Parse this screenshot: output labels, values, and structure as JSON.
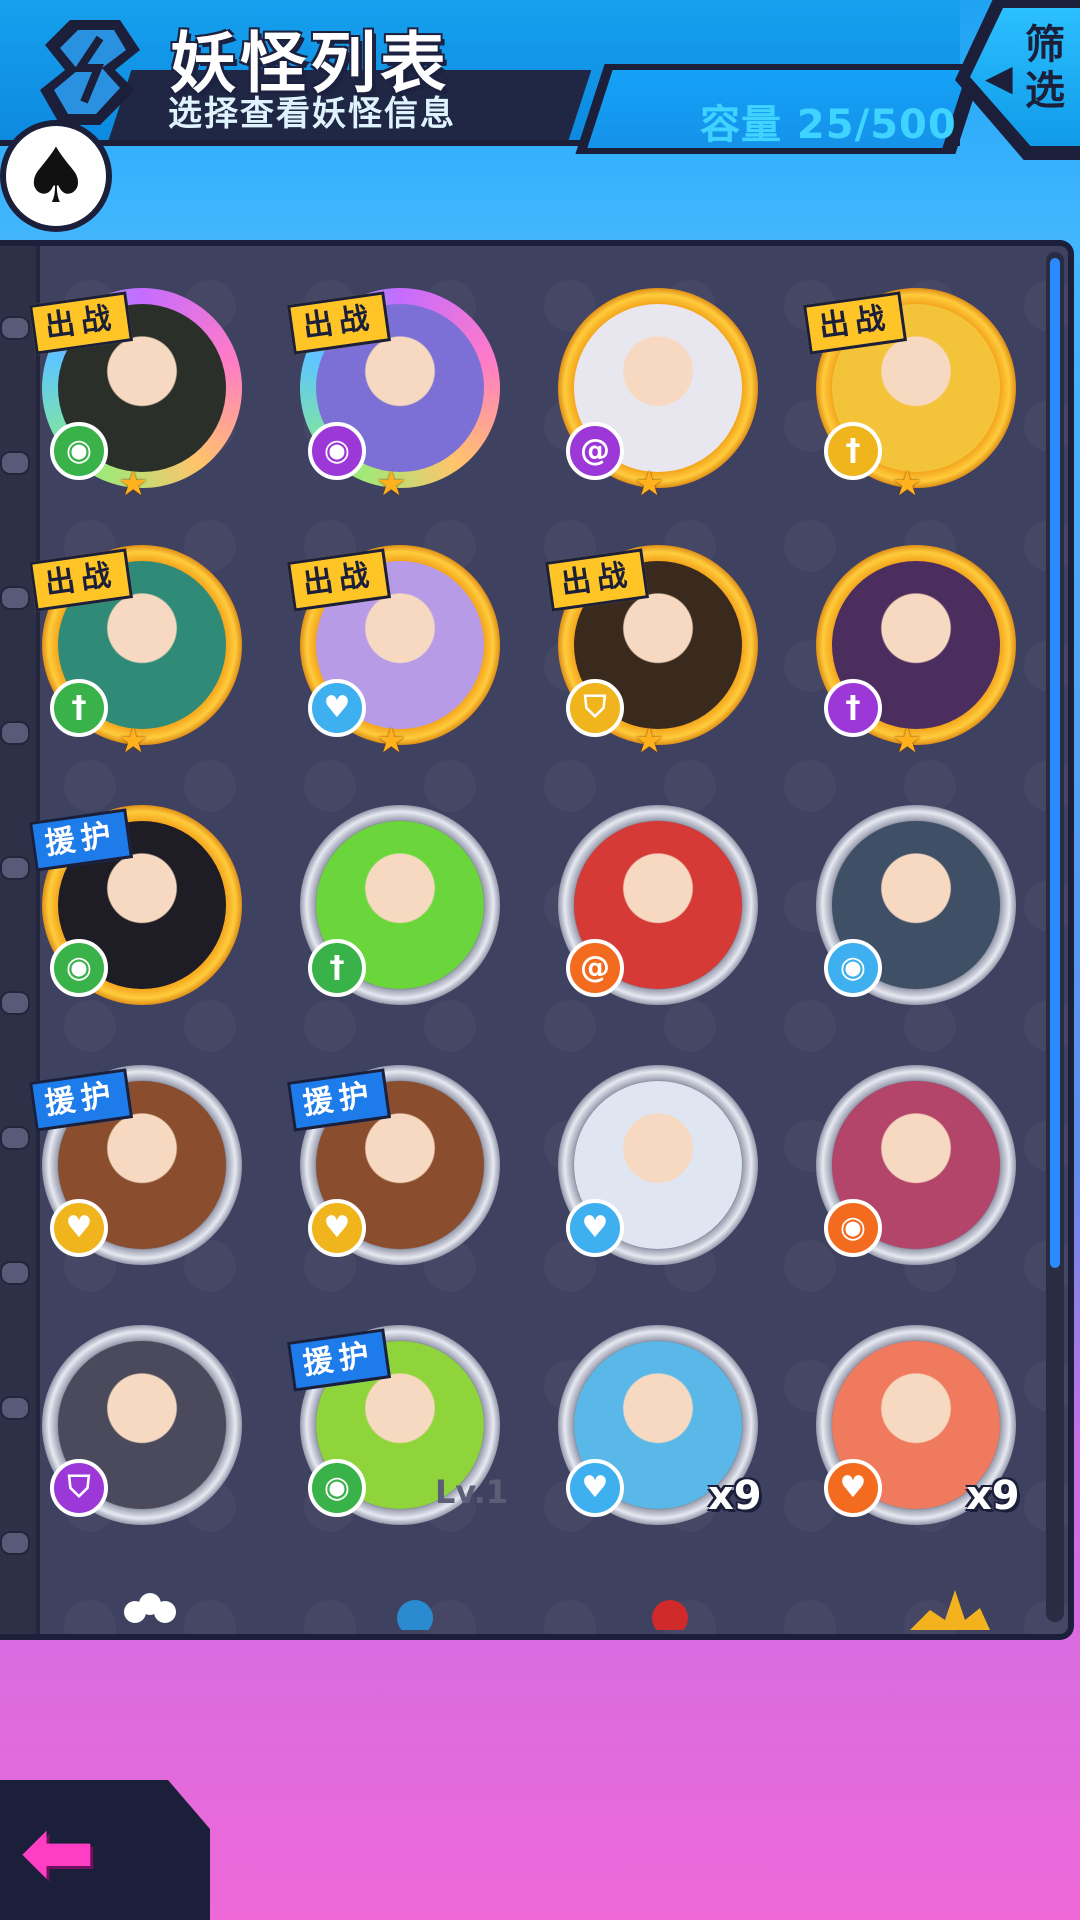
{
  "header": {
    "title": "妖怪列表",
    "subtitle": "选择查看妖怪信息",
    "capacity": "容量 25/500",
    "filter_label": "筛选"
  },
  "colors": {
    "accent": "#16a0ee",
    "panel": "#3f4160",
    "tag_battle": "#ffc526",
    "tag_support": "#1e7bea",
    "back_arrow": "#ff3ec4"
  },
  "monsters": [
    {
      "tag": "出战",
      "ring": "rainbow",
      "type_icon": "eye-icon",
      "type_color": "green",
      "portrait": "#2a2f2a"
    },
    {
      "tag": "出战",
      "ring": "rainbow",
      "type_icon": "eye-icon",
      "type_color": "purple",
      "portrait": "#7c6fd6"
    },
    {
      "tag": "",
      "ring": "gold",
      "type_icon": "swirl-icon",
      "type_color": "purple",
      "portrait": "#e8e6ee"
    },
    {
      "tag": "出战",
      "ring": "gold",
      "type_icon": "sword-icon",
      "type_color": "gold",
      "portrait": "#f3c33a"
    },
    {
      "tag": "出战",
      "ring": "gold",
      "type_icon": "sword-icon",
      "type_color": "green",
      "portrait": "#2f8a78"
    },
    {
      "tag": "出战",
      "ring": "gold",
      "type_icon": "heart-icon",
      "type_color": "blue",
      "portrait": "#b79be6"
    },
    {
      "tag": "出战",
      "ring": "gold",
      "type_icon": "shield-icon",
      "type_color": "gold",
      "portrait": "#3a2a1e"
    },
    {
      "tag": "",
      "ring": "gold",
      "type_icon": "sword-icon",
      "type_color": "purple",
      "portrait": "#4b2d5e"
    },
    {
      "tag": "援护",
      "ring": "gold",
      "type_icon": "eye-icon",
      "type_color": "green",
      "portrait": "#1e1c24"
    },
    {
      "tag": "",
      "ring": "silver",
      "type_icon": "sword-icon",
      "type_color": "green",
      "portrait": "#6ad63c"
    },
    {
      "tag": "",
      "ring": "silver",
      "type_icon": "swirl-icon",
      "type_color": "orange",
      "portrait": "#d53a36"
    },
    {
      "tag": "",
      "ring": "silver",
      "type_icon": "eye-icon",
      "type_color": "blue",
      "portrait": "#3e4f66"
    },
    {
      "tag": "援护",
      "ring": "silver",
      "type_icon": "heart-icon",
      "type_color": "gold",
      "portrait": "#8a4e2e"
    },
    {
      "tag": "援护",
      "ring": "silver",
      "type_icon": "heart-icon",
      "type_color": "gold",
      "portrait": "#8a4e2e"
    },
    {
      "tag": "",
      "ring": "silver",
      "type_icon": "heart-icon",
      "type_color": "blue",
      "portrait": "#dfe6f2"
    },
    {
      "tag": "",
      "ring": "silver",
      "type_icon": "eye-icon",
      "type_color": "orange",
      "portrait": "#b3446a"
    },
    {
      "tag": "",
      "ring": "silver",
      "type_icon": "shield-icon",
      "type_color": "purple",
      "portrait": "#4a4a5c"
    },
    {
      "tag": "援护",
      "ring": "silver",
      "type_icon": "eye-icon",
      "type_color": "green",
      "portrait": "#8fd43a",
      "level": "Lv.1"
    },
    {
      "tag": "",
      "ring": "silver",
      "type_icon": "heart-icon",
      "type_color": "blue",
      "portrait": "#5ab8e8",
      "count": "x9"
    },
    {
      "tag": "",
      "ring": "silver",
      "type_icon": "heart-icon",
      "type_color": "orange",
      "portrait": "#f07a5e",
      "count": "x9"
    }
  ]
}
